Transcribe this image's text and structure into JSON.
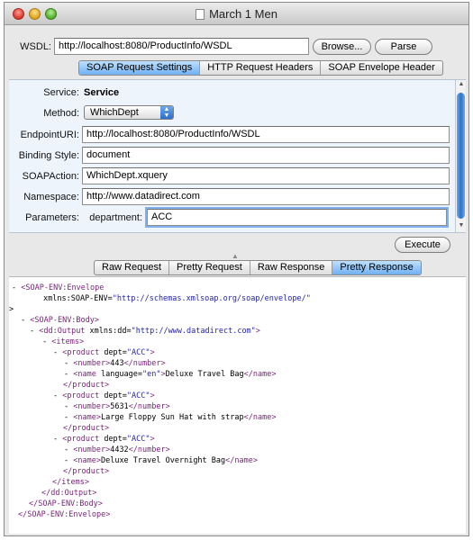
{
  "window": {
    "title": "March 1 Men"
  },
  "wsdl": {
    "label": "WSDL:",
    "value": "http://localhost:8080/ProductInfo/WSDL",
    "browse_label": "Browse...",
    "parse_label": "Parse"
  },
  "settings_tabs": [
    "SOAP Request Settings",
    "HTTP Request Headers",
    "SOAP Envelope Header"
  ],
  "settings": {
    "service_label": "Service:",
    "service_value": "Service",
    "method_label": "Method:",
    "method_value": "WhichDept",
    "endpoint_label": "EndpointURI:",
    "endpoint_value": "http://localhost:8080/ProductInfo/WSDL",
    "binding_label": "Binding Style:",
    "binding_value": "document",
    "soapaction_label": "SOAPAction:",
    "soapaction_value": "WhichDept.xquery",
    "namespace_label": "Namespace:",
    "namespace_value": "http://www.datadirect.com",
    "parameters_label": "Parameters:",
    "param_name": "department:",
    "param_value": "ACC"
  },
  "execute_label": "Execute",
  "response_tabs": [
    "Raw Request",
    "Pretty Request",
    "Raw Response",
    "Pretty Response"
  ],
  "xml": {
    "l1_tog": "-",
    "l1": "<SOAP-ENV:Envelope",
    "l2_attr": "xmlns:SOAP-ENV=",
    "l2_val": "\"http://schemas.xmlsoap.org/soap/envelope/\"",
    "l3": ">",
    "l4_tog": "-",
    "l4": "<SOAP-ENV:Body>",
    "l5_tog": "-",
    "l5_tag": "<dd:Output",
    "l5_attr": " xmlns:dd=",
    "l5_val": "\"http://www.datadirect.com\"",
    "l5_end": ">",
    "l6_tog": "-",
    "l6": "<items>",
    "p1_tog": "-",
    "p1_tag": "<product",
    "p1_attr": " dept=",
    "p1_val": "\"ACC\"",
    "p1_end": ">",
    "p1_num_tog": "-",
    "p1_num_open": "<number>",
    "p1_num": "443",
    "p1_num_close": "</number>",
    "p1_name_tog": "-",
    "p1_name_open": "<name",
    "p1_name_attr": " language=",
    "p1_name_val": "\"en\"",
    "p1_name_gt": ">",
    "p1_name": "Deluxe Travel Bag",
    "p1_name_close": "</name>",
    "p1_close": "</product>",
    "p2_tog": "-",
    "p2_tag": "<product",
    "p2_attr": " dept=",
    "p2_val": "\"ACC\"",
    "p2_end": ">",
    "p2_num_tog": "-",
    "p2_num_open": "<number>",
    "p2_num": "5631",
    "p2_num_close": "</number>",
    "p2_name_tog": "-",
    "p2_name_open": "<name>",
    "p2_name": "Large Floppy Sun Hat with strap",
    "p2_name_close": "</name>",
    "p2_close": "</product>",
    "p3_tog": "-",
    "p3_tag": "<product",
    "p3_attr": " dept=",
    "p3_val": "\"ACC\"",
    "p3_end": ">",
    "p3_num_tog": "-",
    "p3_num_open": "<number>",
    "p3_num": "4432",
    "p3_num_close": "</number>",
    "p3_name_tog": "-",
    "p3_name_open": "<name>",
    "p3_name": "Deluxe Travel Overnight Bag",
    "p3_name_close": "</name>",
    "p3_close": "</product>",
    "items_close": "</items>",
    "output_close": "</dd:Output>",
    "body_close": "</SOAP-ENV:Body>",
    "env_close": "</SOAP-ENV:Envelope>"
  }
}
